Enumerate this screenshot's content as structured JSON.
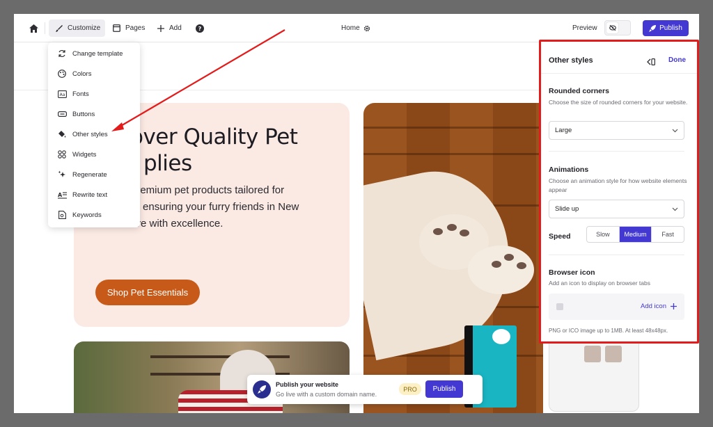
{
  "toolbar": {
    "customize_label": "Customize",
    "pages_label": "Pages",
    "add_label": "Add",
    "current_page": "Home",
    "preview_label": "Preview",
    "publish_label": "Publish"
  },
  "customize_menu": {
    "items": [
      {
        "label": "Change template",
        "icon": "refresh-icon"
      },
      {
        "label": "Colors",
        "icon": "palette-icon"
      },
      {
        "label": "Fonts",
        "icon": "font-icon"
      },
      {
        "label": "Buttons",
        "icon": "button-icon"
      },
      {
        "label": "Other styles",
        "icon": "paint-bucket-icon"
      },
      {
        "label": "Widgets",
        "icon": "grid-icon"
      },
      {
        "label": "Regenerate",
        "icon": "sparkle-icon"
      },
      {
        "label": "Rewrite text",
        "icon": "text-icon"
      },
      {
        "label": "Keywords",
        "icon": "document-icon"
      }
    ]
  },
  "hero": {
    "title_line1": "over Quality Pet",
    "title_line2": "plies",
    "desc_line1": "premium pet products tailored for",
    "desc_line2": "ed, ensuring your furry friends in New",
    "desc_line3": "York thrive with excellence.",
    "cta": "Shop Pet Essentials"
  },
  "publish_banner": {
    "title": "Publish your website",
    "subtitle": "Go live with a custom domain name.",
    "badge": "PRO",
    "button": "Publish"
  },
  "panel": {
    "title": "Other styles",
    "done_label": "Done",
    "rounded": {
      "title": "Rounded corners",
      "desc": "Choose the size of rounded corners for your website.",
      "value": "Large"
    },
    "animations": {
      "title": "Animations",
      "desc": "Choose an animation style for how website elements appear",
      "value": "Slide up"
    },
    "speed": {
      "label": "Speed",
      "options": [
        "Slow",
        "Medium",
        "Fast"
      ],
      "selected": "Medium"
    },
    "browser_icon": {
      "title": "Browser icon",
      "desc": "Add an icon to display on browser tabs",
      "add_label": "Add icon",
      "hint": "PNG or ICO image up to 1MB. At least 48x48px."
    }
  },
  "colors": {
    "accent": "#4339d2",
    "cta": "#c85a19",
    "hero_bg": "#fbe9e3",
    "annotation": "#e31b1b"
  }
}
